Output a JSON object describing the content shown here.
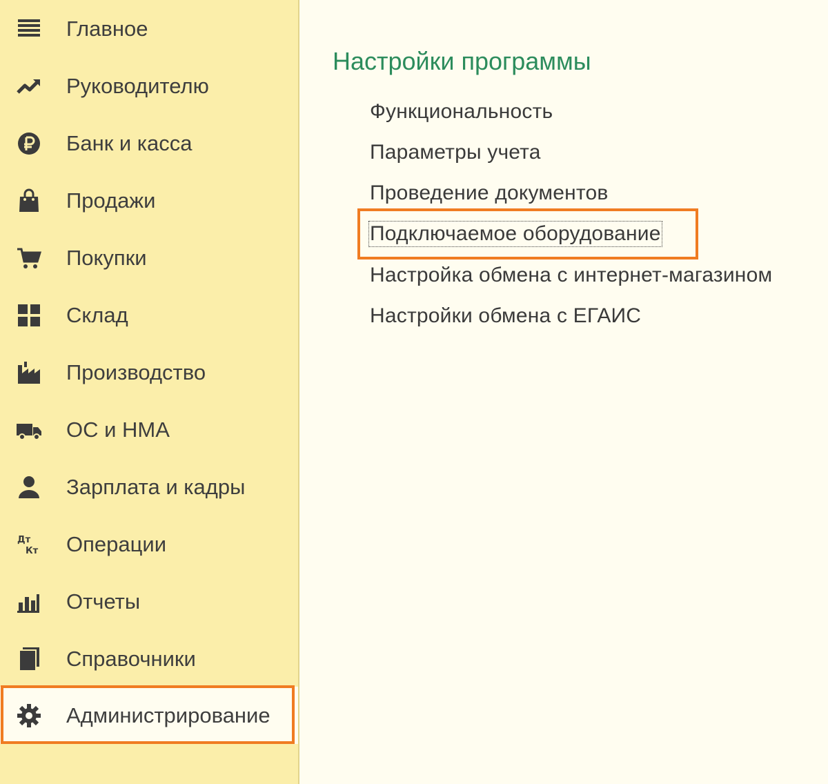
{
  "sidebar": {
    "items": [
      {
        "label": "Главное",
        "icon": "menu-icon"
      },
      {
        "label": "Руководителю",
        "icon": "trend-icon"
      },
      {
        "label": "Банк и касса",
        "icon": "ruble-icon"
      },
      {
        "label": "Продажи",
        "icon": "shopping-bag-icon"
      },
      {
        "label": "Покупки",
        "icon": "cart-icon"
      },
      {
        "label": "Склад",
        "icon": "grid-icon"
      },
      {
        "label": "Производство",
        "icon": "factory-icon"
      },
      {
        "label": "ОС и НМА",
        "icon": "truck-icon"
      },
      {
        "label": "Зарплата и кадры",
        "icon": "person-icon"
      },
      {
        "label": "Операции",
        "icon": "dt-kt-icon"
      },
      {
        "label": "Отчеты",
        "icon": "bar-chart-icon"
      },
      {
        "label": "Справочники",
        "icon": "books-icon"
      },
      {
        "label": "Администрирование",
        "icon": "gear-icon"
      }
    ],
    "active_index": 12
  },
  "main": {
    "section_title": "Настройки программы",
    "links": [
      {
        "label": "Функциональность"
      },
      {
        "label": "Параметры учета"
      },
      {
        "label": "Проведение документов"
      },
      {
        "label": "Подключаемое оборудование"
      },
      {
        "label": "Настройка обмена с интернет-магазином"
      },
      {
        "label": "Настройки обмена с ЕГАИС"
      }
    ],
    "focused_index": 3
  },
  "colors": {
    "sidebar_bg": "#fbeeaa",
    "content_bg": "#fffdf0",
    "title_green": "#2c8c5c",
    "highlight_orange": "#f07c22"
  }
}
